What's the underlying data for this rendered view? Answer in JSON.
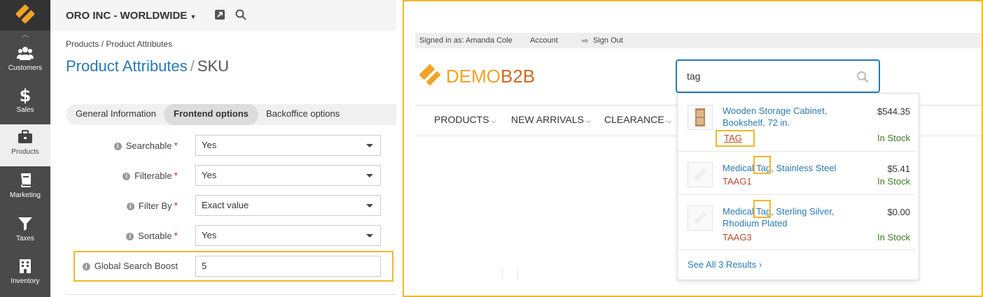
{
  "admin": {
    "sidebar": [
      {
        "label": "Customers",
        "icon": "users-icon"
      },
      {
        "label": "Sales",
        "icon": "dollar-icon"
      },
      {
        "label": "Products",
        "icon": "briefcase-icon"
      },
      {
        "label": "Marketing",
        "icon": "book-icon"
      },
      {
        "label": "Taxes",
        "icon": "filter-icon"
      },
      {
        "label": "Inventory",
        "icon": "building-icon"
      }
    ],
    "org_name": "ORO INC - WORLDWIDE",
    "breadcrumb": "Products / Product Attributes",
    "title_main": "Product Attributes",
    "title_sep": "/",
    "title_sub": "SKU",
    "tabs": [
      "General Information",
      "Frontend options",
      "Backoffice options"
    ],
    "fields": [
      {
        "label": "Searchable",
        "value": "Yes",
        "required": "*"
      },
      {
        "label": "Filterable",
        "value": "Yes",
        "required": "*"
      },
      {
        "label": "Filter By",
        "value": "Exact value",
        "required": "*"
      },
      {
        "label": "Sortable",
        "value": "Yes",
        "required": "*"
      }
    ],
    "boost": {
      "label": "Global Search Boost",
      "value": "5"
    },
    "info_glyph": "i"
  },
  "store": {
    "signed_in": "Signed in as: Amanda Cole",
    "account": "Account",
    "sign_out": "Sign Out",
    "logo_part1": "DEMO",
    "logo_part2": "B2B",
    "search_value": "tag",
    "menu": [
      "PRODUCTS",
      "NEW ARRIVALS",
      "CLEARANCE"
    ],
    "results": [
      {
        "name": "Wooden Storage Cabinet, Bookshelf, 72 in.",
        "price": "$544.35",
        "sku": "TAG",
        "stock": "In Stock"
      },
      {
        "name": "Medical Tag, Stainless Steel",
        "price": "$5.41",
        "sku": "TAAG1",
        "stock": "In Stock"
      },
      {
        "name": "Medical Tag, Sterling Silver, Rhodium Plated",
        "price": "$0.00",
        "sku": "TAAG3",
        "stock": "In Stock"
      }
    ],
    "see_all": "See All 3 Results ›"
  },
  "colors": {
    "accent": "#f1b72b",
    "link": "#2a7ab0",
    "sidebar": "#4a4a4a"
  }
}
